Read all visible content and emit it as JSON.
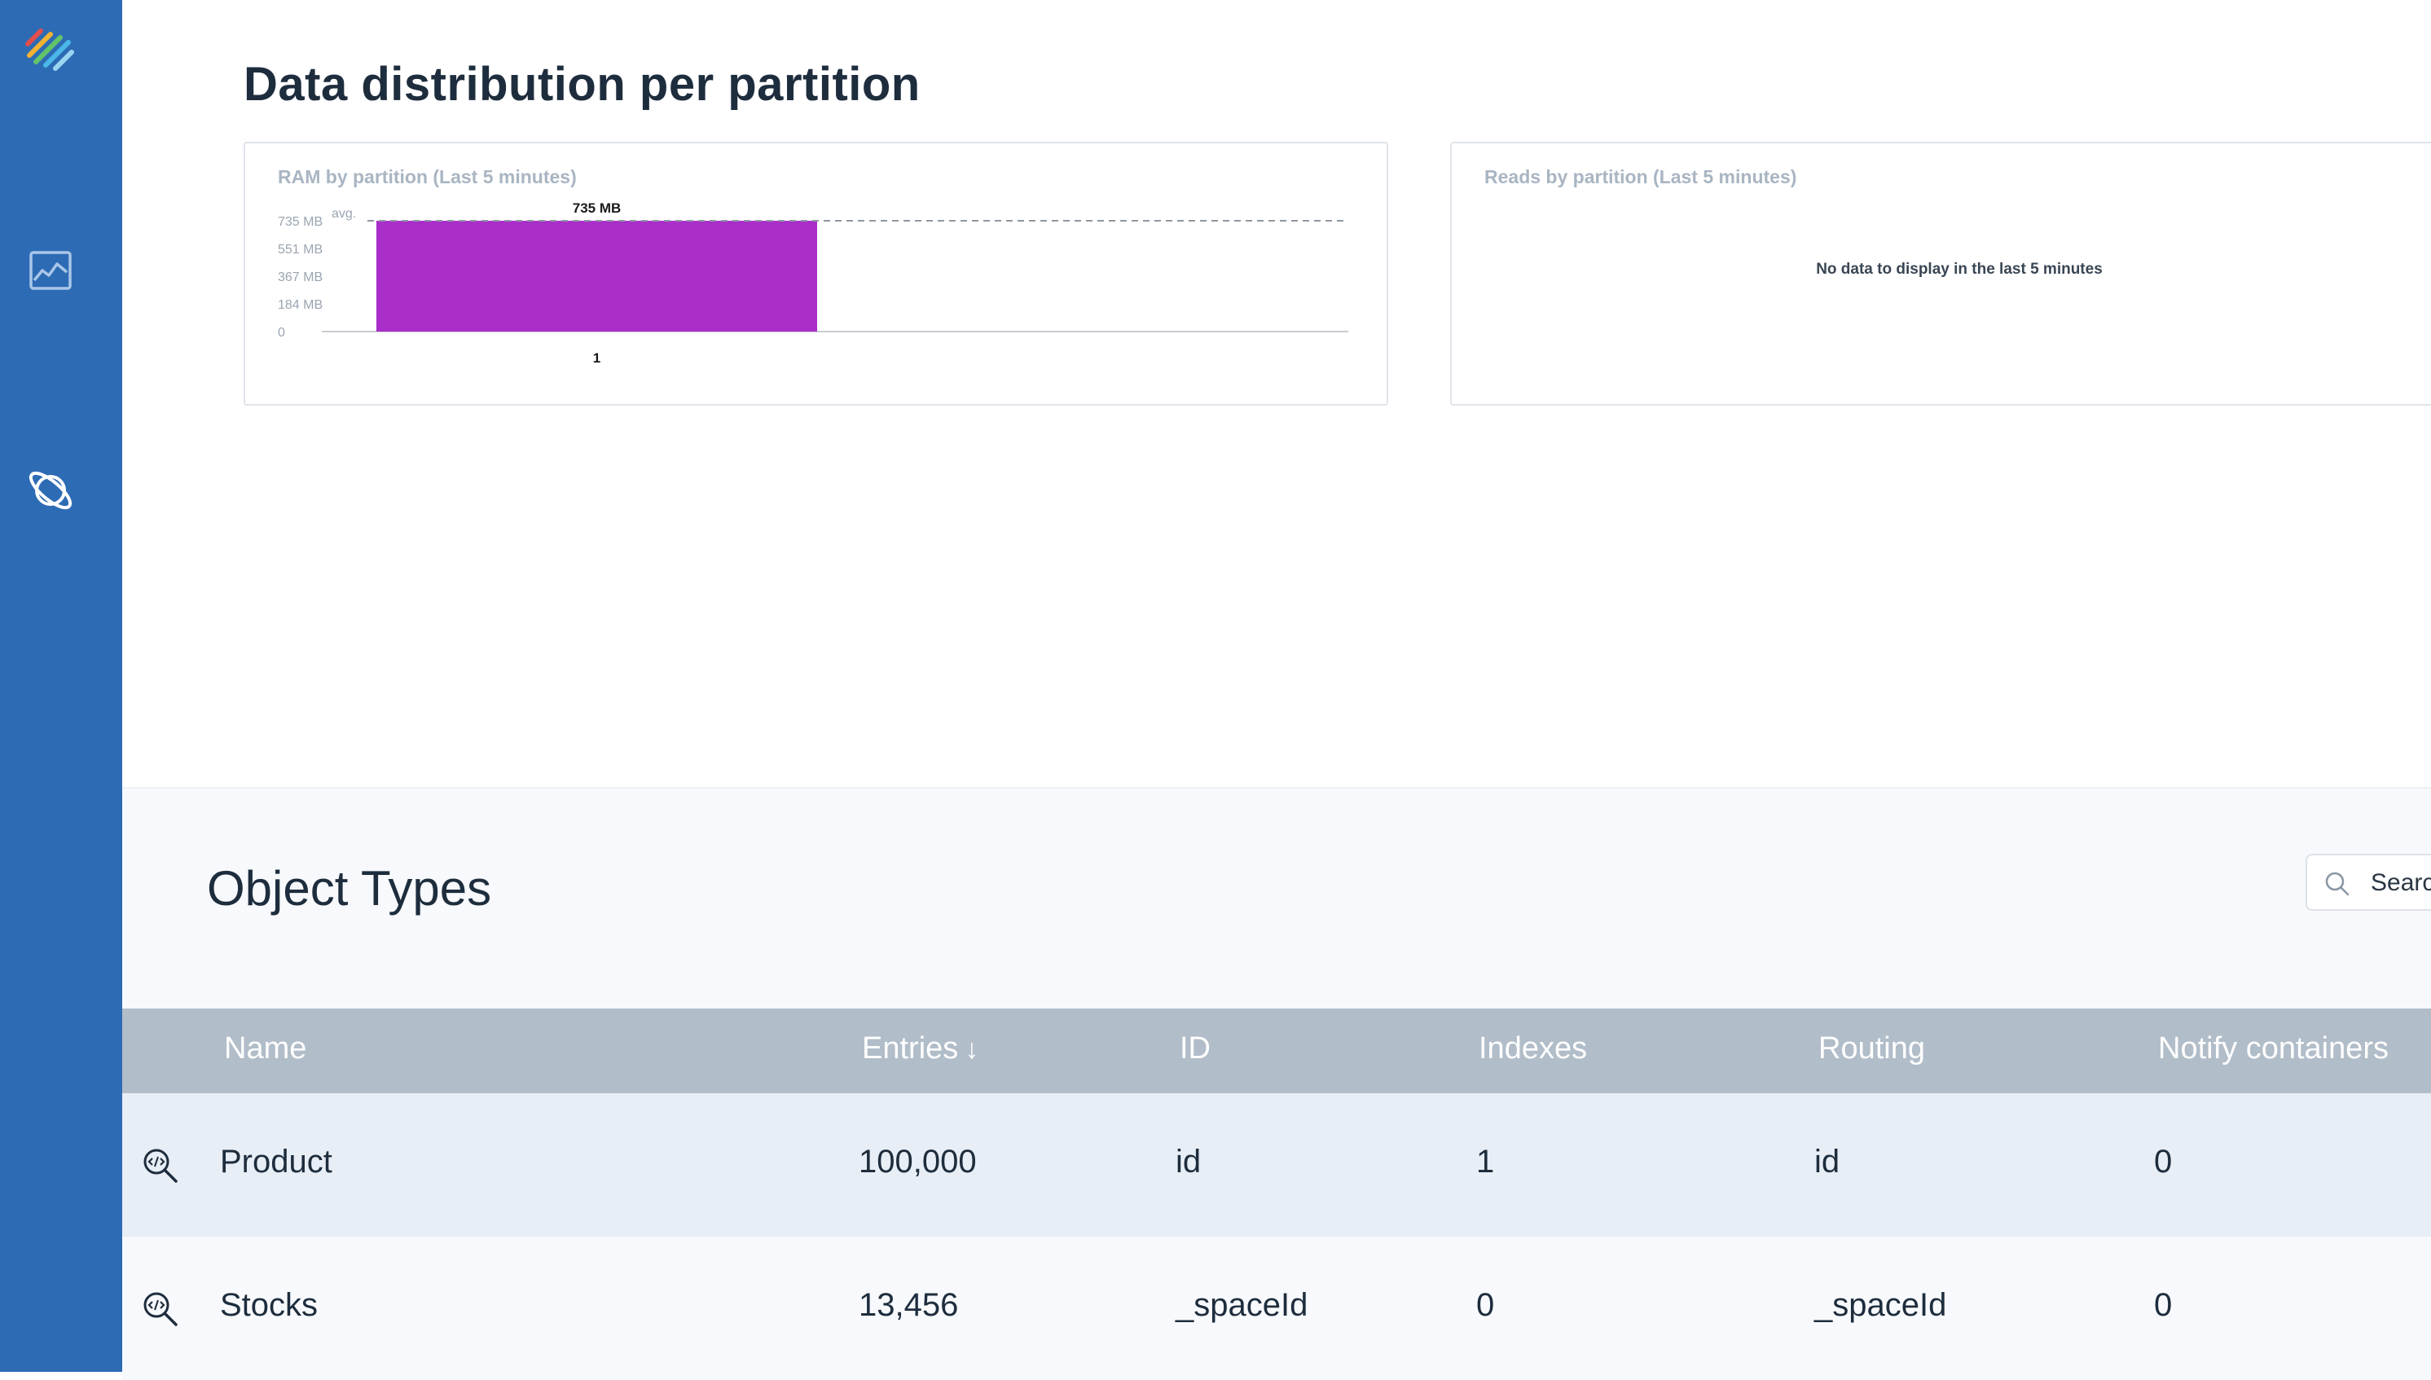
{
  "sidebar": {
    "items": [
      {
        "icon": "app-logo-icon"
      },
      {
        "icon": "chart-icon"
      },
      {
        "icon": "planet-icon"
      }
    ],
    "colors": {
      "background": "#2d6bb5"
    }
  },
  "header": {
    "title": "Data distribution per partition"
  },
  "panels": {
    "ram": {
      "title": "RAM by partition (Last 5 minutes)"
    },
    "reads": {
      "title": "Reads by partition (Last 5 minutes)",
      "empty_message": "No data to display in the last 5 minutes"
    }
  },
  "chart_data": {
    "type": "bar",
    "title": "RAM by partition (Last 5 minutes)",
    "categories": [
      "1"
    ],
    "values": [
      735
    ],
    "value_labels": [
      "735 MB"
    ],
    "unit": "MB",
    "y_ticks": [
      "0",
      "184 MB",
      "367 MB",
      "551 MB",
      "735 MB"
    ],
    "y_tick_values": [
      0,
      184,
      367,
      551,
      735
    ],
    "ylim": [
      0,
      735
    ],
    "average": 735,
    "average_label": "avg.",
    "bar_color": "#a92ec9"
  },
  "object_types": {
    "title": "Object Types",
    "search": {
      "placeholder": "Search"
    },
    "columns": [
      "Name",
      "Entries",
      "ID",
      "Indexes",
      "Routing",
      "Notify containers"
    ],
    "sorted_column": "Entries",
    "rows": [
      {
        "name": "Product",
        "entries": "100,000",
        "id": "id",
        "indexes": "1",
        "routing": "id",
        "notify": "0"
      },
      {
        "name": "Stocks",
        "entries": "13,456",
        "id": "_spaceId",
        "indexes": "0",
        "routing": "_spaceId",
        "notify": "0"
      }
    ],
    "row_icon": "inspect-type-icon"
  }
}
